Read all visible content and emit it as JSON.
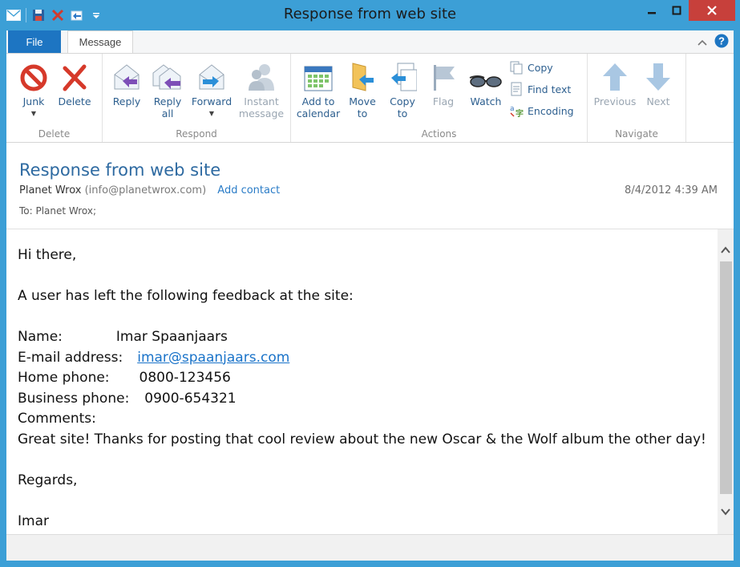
{
  "window": {
    "title": "Response from web site"
  },
  "tabs": {
    "file": "File",
    "message": "Message"
  },
  "ribbon": {
    "groups": {
      "delete": "Delete",
      "respond": "Respond",
      "actions": "Actions",
      "navigate": "Navigate"
    },
    "junk": [
      "Junk",
      ""
    ],
    "delete": [
      "Delete",
      ""
    ],
    "reply": [
      "Reply",
      ""
    ],
    "reply_all": [
      "Reply",
      "all"
    ],
    "forward": [
      "Forward",
      ""
    ],
    "instant_message": [
      "Instant",
      "message"
    ],
    "add_to_calendar": [
      "Add to",
      "calendar"
    ],
    "move_to": [
      "Move",
      "to"
    ],
    "copy_to": [
      "Copy",
      "to"
    ],
    "flag": [
      "Flag",
      ""
    ],
    "watch": [
      "Watch",
      ""
    ],
    "copy": "Copy",
    "find_text": "Find text",
    "encoding": "Encoding",
    "previous": "Previous",
    "next": "Next"
  },
  "message": {
    "subject": "Response from web site",
    "from_name": "Planet Wrox",
    "from_email": "(info@planetwrox.com)",
    "add_contact": "Add contact",
    "date": "8/4/2012 4:39 AM",
    "to": "To: Planet Wrox;"
  },
  "body": {
    "greeting": "Hi there,",
    "intro": "A user has left the following feedback at the site:",
    "name_label": "Name:",
    "name_value": "Imar Spaanjaars",
    "email_label": "E-mail address:",
    "email_value": "imar@spaanjaars.com",
    "home_label": "Home phone:",
    "home_value": "0800-123456",
    "business_label": "Business phone:",
    "business_value": "0900-654321",
    "comments_label": "Comments:",
    "comments_value": "Great site! Thanks for posting that cool review about the new Oscar & the Wolf album the other day!",
    "regards": "Regards,",
    "signature": "Imar"
  }
}
